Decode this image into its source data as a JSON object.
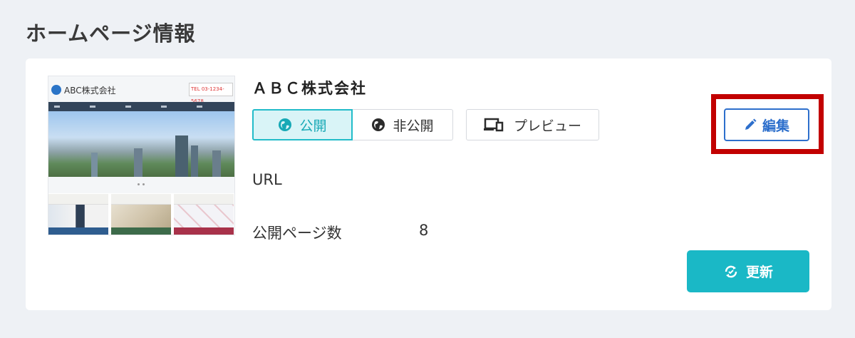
{
  "section": {
    "title": "ホームページ情報"
  },
  "site": {
    "thumbnail": {
      "logo_text": "ABC株式会社",
      "contact_text": "TEL 03-1234-5678"
    },
    "company_name": "ＡＢＣ株式会社",
    "visibility": {
      "public_label": "公開",
      "private_label": "非公開",
      "selected": "公開"
    },
    "preview_label": "プレビュー",
    "edit_label": "編集",
    "url_label": "URL",
    "pages_label": "公開ページ数",
    "pages_count": "8",
    "refresh_label": "更新"
  },
  "colors": {
    "accent_teal": "#1ab8c6",
    "edit_blue": "#2d6fcc",
    "highlight_red": "#c20000"
  }
}
